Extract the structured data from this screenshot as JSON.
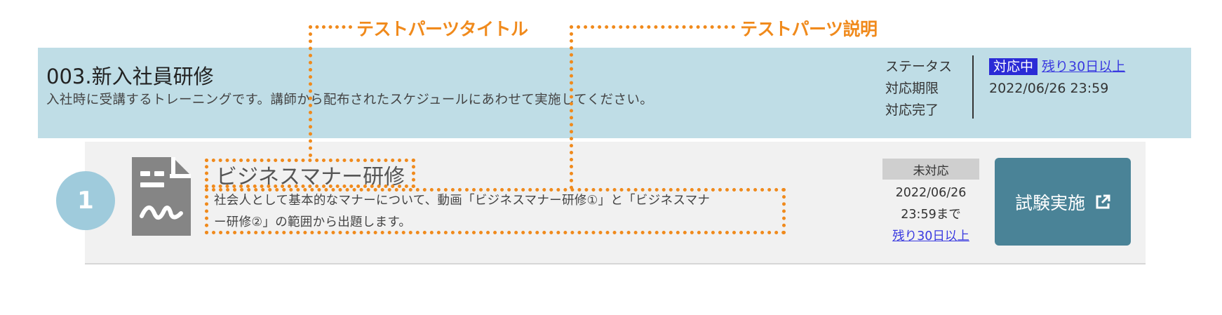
{
  "annotations": {
    "title_label": "テストパーツタイトル",
    "description_label": "テストパーツ説明"
  },
  "course": {
    "title": "003.新入社員研修",
    "description": "入社時に受講するトレーニングです。講師から配布されたスケジュールにあわせて実施してください。",
    "status_labels": {
      "status": "ステータス",
      "deadline": "対応期限",
      "completed": "対応完了"
    },
    "status_badge": "対応中",
    "remaining": "残り30日以上",
    "deadline_value": "2022/06/26 23:59"
  },
  "part": {
    "number": "1",
    "title": "ビジネスマナー研修",
    "description_line1": "社会人として基本的なマナーについて、動画「ビジネスマナー研修①」と「ビジネスマナ",
    "description_line2": "ー研修②」の範囲から出題します。",
    "status_badge": "未対応",
    "deadline_date": "2022/06/26",
    "deadline_time": "23:59まで",
    "remaining": "残り30日以上",
    "action_label": "試験実施",
    "icons": {
      "document": "document-signature-icon",
      "external": "external-link-icon"
    }
  },
  "colors": {
    "annotation": "#f08a1c",
    "course_band": "#bfdde6",
    "active_badge": "#2b2bd6",
    "link": "#3a3ae0",
    "button": "#4a8397",
    "number_circle": "#9fcbdc",
    "card_bg": "#f1f1f1"
  }
}
